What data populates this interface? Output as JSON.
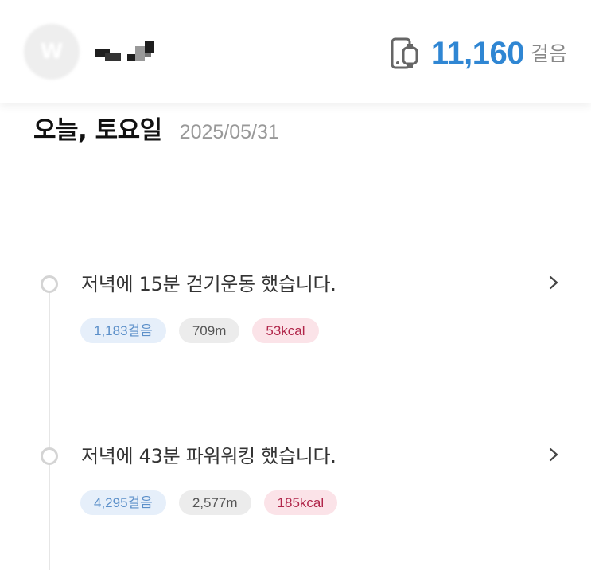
{
  "header": {
    "avatar_letter": "W",
    "total_steps": "11,160",
    "steps_unit": "걸음",
    "icon": "phone-watch-icon"
  },
  "date": {
    "title": "오늘, 토요일",
    "value": "2025/05/31"
  },
  "activities": [
    {
      "title": "저녁에 15분 걷기운동 했습니다.",
      "steps": "1,183걸음",
      "distance": "709m",
      "kcal": "53kcal"
    },
    {
      "title": "저녁에 43분 파워워킹 했습니다.",
      "steps": "4,295걸음",
      "distance": "2,577m",
      "kcal": "185kcal"
    }
  ],
  "colors": {
    "accent": "#2f86d3",
    "steps_tag_bg": "#e6effa",
    "kcal_tag_text": "#b1264a"
  }
}
